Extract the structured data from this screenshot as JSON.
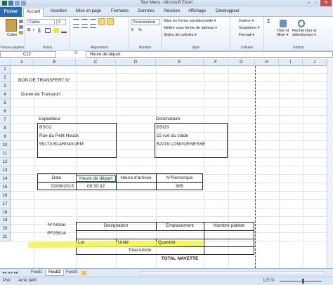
{
  "window": {
    "title": "Test Menu  -  Microsoft Excel",
    "controls": [
      "–",
      "▫",
      "✕"
    ]
  },
  "ribbon_tabs": [
    "Fichier",
    "Accueil",
    "Insertion",
    "Mise en page",
    "Formules",
    "Données",
    "Révision",
    "Affichage",
    "Développeur"
  ],
  "ribbon": {
    "paste_label": "Coller",
    "font_name": "Calibri",
    "font_size": "9",
    "number_format": "Personnalis▾",
    "cond_format": "Mise en forme conditionnelle ▾",
    "table_format": "Mettre sous forme de tableau ▾",
    "cell_styles": "Styles de cellules ▾",
    "insert": "Insérer ▾",
    "delete": "Supprimer ▾",
    "format": "Format ▾",
    "sort_filter": "Trier et filtrer ▾",
    "find_select": "Rechercher et sélectionner ▾",
    "groups": [
      "Presse-papiers",
      "Police",
      "Alignement",
      "Nombre",
      "Style",
      "Cellules",
      "Édition"
    ]
  },
  "formula_bar": {
    "name_box": "C12",
    "fx": "fx",
    "content": "Heure de départ"
  },
  "columns": [
    "A",
    "B",
    "C",
    "D",
    "E",
    "F",
    "G",
    "H",
    "I",
    "J"
  ],
  "rows": [
    "1",
    "2",
    "3",
    "4",
    "5",
    "6",
    "7",
    "8",
    "9",
    "10",
    "11",
    "12",
    "13",
    "14",
    "15",
    "16",
    "17",
    "18",
    "19",
    "20",
    "21"
  ],
  "cells": {
    "title": "BON DE TRANSFERT N°",
    "transport": "Durée de Transport :",
    "expediteur_label": "Expéditeur",
    "expediteur": [
      "BSO2",
      "Rue du Petit Houck",
      "59173 BLARINGUEM"
    ],
    "destinataire_label": "Destinataire",
    "destinataire": [
      "BSO3",
      "15 rue du stade",
      "62219 LONGUENESSE"
    ],
    "info_headers": [
      "Date",
      "Heure de départ",
      "Heure d'arrivée",
      "N°Remorque"
    ],
    "info_values": [
      "02/06/2015",
      "09:30:32",
      "",
      "985"
    ],
    "article_label": "N°Article",
    "article_value": "PF25614",
    "designation": "Designation",
    "emplacement": "Emplacement",
    "nombre_palette": "Nombre palette",
    "lot": "Lot",
    "unite": "Unité",
    "quantite": "Quantité",
    "total_article": "Total Article",
    "total_navette": "TOTAL NAVETTE"
  },
  "sheets": [
    "Feuil1",
    "Feuil2",
    "Feuil3"
  ],
  "active_sheet": "Feuil2",
  "status": {
    "ready": "Prêt",
    "scroll": "Arrêt défil.",
    "zoom": "115 %"
  }
}
